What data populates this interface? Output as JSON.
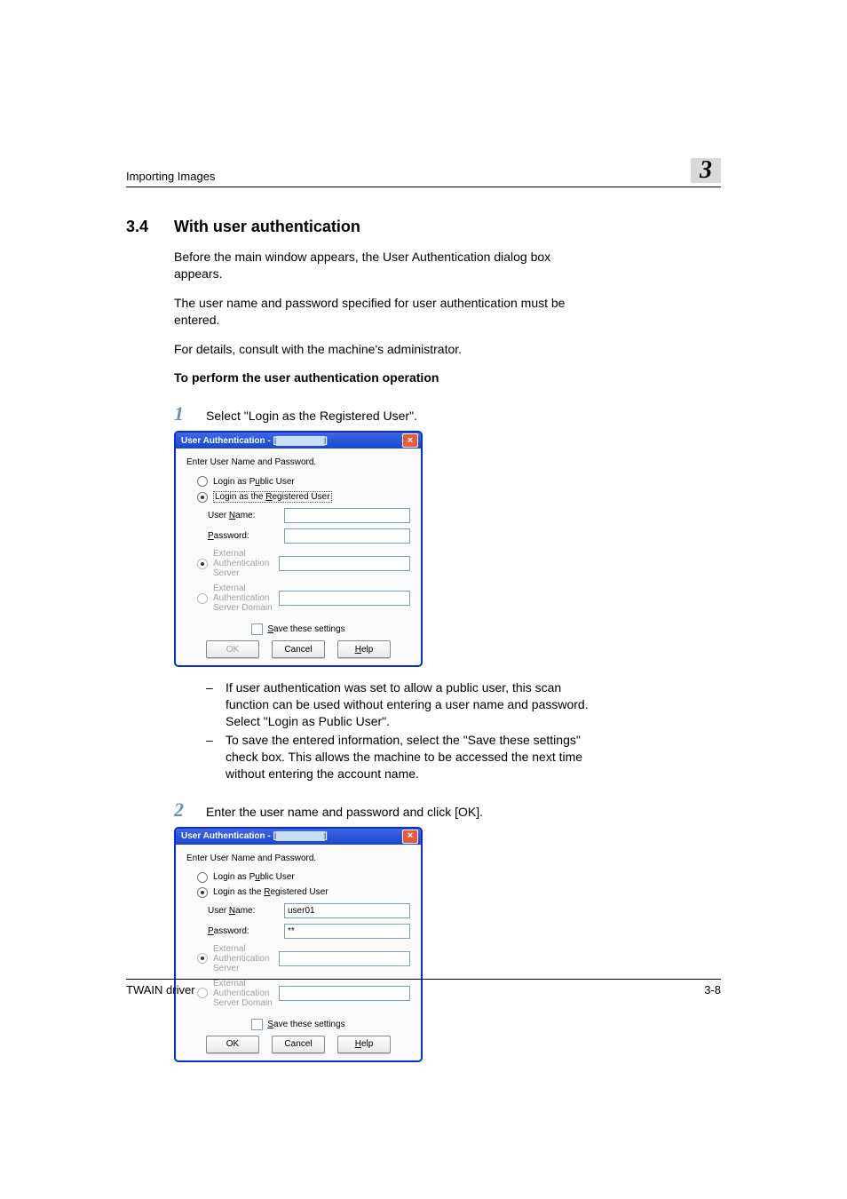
{
  "runhead": {
    "left": "Importing Images",
    "chapnum": "3"
  },
  "section": {
    "num": "3.4",
    "title": "With user authentication"
  },
  "paras": {
    "p1": "Before the main window appears, the User Authentication dialog box appears.",
    "p2": "The user name and password specified for user authentication must be entered.",
    "p3": "For details, consult with the machine's administrator.",
    "h4": "To perform the user authentication operation"
  },
  "steps": {
    "s1num": "1",
    "s1": "Select \"Login as the Registered User\".",
    "s2num": "2",
    "s2": "Enter the user name and password and click [OK]."
  },
  "bullets": {
    "b1": "If user authentication was set to allow a public user, this scan function can be used without entering a user name and password. Select \"Login as Public User\".",
    "b2": "To save the entered information, select the \"Save these settings\" check box. This allows the machine to be accessed the next time without entering the account name."
  },
  "dialog": {
    "title_prefix": "User Authentication - [",
    "title_redact": "▇▇ ▇ ▇▇ ▇",
    "title_suffix": "]",
    "prompt": "Enter User Name and Password.",
    "radio_public_pre": "Login as P",
    "radio_public_u": "u",
    "radio_public_post": "blic User",
    "radio_reg_pre": "Login as the ",
    "radio_reg_u": "R",
    "radio_reg_post": "egistered User",
    "field_user_pre": "User ",
    "field_user_u": "N",
    "field_user_post": "ame:",
    "field_pass_u": "P",
    "field_pass_post": "assword:",
    "field_eas": "External Authentication Server",
    "field_ead": "External Authentication Server Domain",
    "save_pre": "",
    "save_u": "S",
    "save_post": "ave these settings",
    "btn_ok": "OK",
    "btn_cancel": "Cancel",
    "btn_help_u": "H",
    "btn_help_post": "elp",
    "val_user": "user01",
    "val_pass": "**"
  },
  "footer": {
    "left": "TWAIN driver",
    "right": "3-8"
  }
}
